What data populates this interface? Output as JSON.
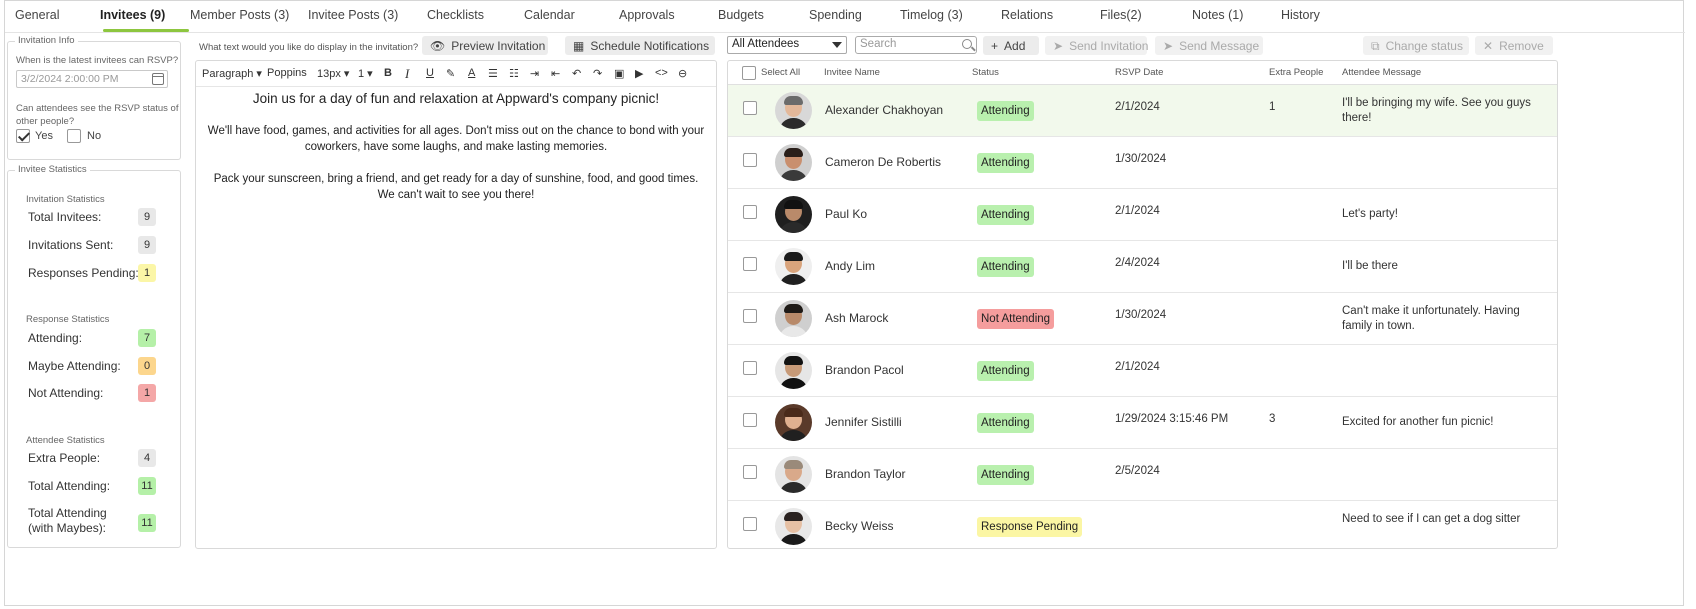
{
  "tabs": [
    {
      "label": "General"
    },
    {
      "label": "Invitees (9)"
    },
    {
      "label": "Member Posts (3)"
    },
    {
      "label": "Invitee Posts (3)"
    },
    {
      "label": "Checklists"
    },
    {
      "label": "Calendar"
    },
    {
      "label": "Approvals"
    },
    {
      "label": "Budgets"
    },
    {
      "label": "Spending"
    },
    {
      "label": "Timelog (3)"
    },
    {
      "label": "Relations"
    },
    {
      "label": "Files(2)"
    },
    {
      "label": "Notes (1)"
    },
    {
      "label": "History"
    }
  ],
  "active_tab": "Invitees (9)",
  "invitation_info": {
    "legend": "Invitation Info",
    "rsvp_question": "When is the latest invitees can RSVP?",
    "rsvp_date": "3/2/2024 2:00:00 PM",
    "visibility_question": "Can attendees see the RSVP status of other people?",
    "yes_label": "Yes",
    "yes_checked": true,
    "no_label": "No",
    "no_checked": false
  },
  "stats": {
    "legend": "Invitee Statistics",
    "invitation_heading": "Invitation Statistics",
    "total_invitees_label": "Total Invitees:",
    "total_invitees": "9",
    "invitations_sent_label": "Invitations Sent:",
    "invitations_sent": "9",
    "responses_pending_label": "Responses Pending:",
    "responses_pending": "1",
    "response_heading": "Response Statistics",
    "attending_label": "Attending:",
    "attending": "7",
    "maybe_label": "Maybe Attending:",
    "maybe": "0",
    "not_attending_label": "Not Attending:",
    "not_attending": "1",
    "attendee_heading": "Attendee Statistics",
    "extra_people_label": "Extra People:",
    "extra_people": "4",
    "total_attending_label": "Total Attending:",
    "total_attending": "11",
    "total_with_maybes_label": "Total Attending (with Maybes):",
    "total_with_maybes": "11"
  },
  "editor": {
    "question": "What text would you like do display in the invitation?",
    "preview_button": "Preview Invitation",
    "schedule_button": "Schedule Notifications",
    "block_format": "Paragraph",
    "font_name": "Poppins",
    "font_size": "13px",
    "line_height": "1",
    "paragraphs": [
      "Join us for a day of fun and relaxation at Appward's company picnic!",
      "We'll have food, games, and activities for all ages. Don't miss out on the chance to bond with your coworkers, have some laughs, and make lasting memories.",
      "Pack your sunscreen, bring a friend, and get ready for a day of sunshine, food, and good times. We can't wait to see you there!"
    ]
  },
  "toolbar": {
    "filter_value": "All Attendees",
    "search_placeholder": "Search",
    "add_label": "Add",
    "send_invitation_label": "Send Invitation",
    "send_message_label": "Send Message",
    "change_status_label": "Change status",
    "remove_label": "Remove"
  },
  "table": {
    "columns": [
      "Select All",
      "Invitee Name",
      "Status",
      "RSVP Date",
      "Extra People",
      "Attendee Message"
    ],
    "rows": [
      {
        "name": "Alexander Chakhoyan",
        "status": "Attending",
        "rsvp": "2/1/2024",
        "extra": "1",
        "message": "I'll be bringing my wife. See you guys there!"
      },
      {
        "name": "Cameron De Robertis",
        "status": "Attending",
        "rsvp": "1/30/2024",
        "extra": "",
        "message": ""
      },
      {
        "name": "Paul Ko",
        "status": "Attending",
        "rsvp": "2/1/2024",
        "extra": "",
        "message": "Let's party!"
      },
      {
        "name": "Andy Lim",
        "status": "Attending",
        "rsvp": "2/4/2024",
        "extra": "",
        "message": "I'll be there"
      },
      {
        "name": "Ash Marock",
        "status": "Not Attending",
        "rsvp": "1/30/2024",
        "extra": "",
        "message": "Can't make it unfortunately. Having family in town."
      },
      {
        "name": "Brandon Pacol",
        "status": "Attending",
        "rsvp": "2/1/2024",
        "extra": "",
        "message": ""
      },
      {
        "name": "Jennifer Sistilli",
        "status": "Attending",
        "rsvp": "1/29/2024 3:15:46 PM",
        "extra": "3",
        "message": "Excited for another fun picnic!"
      },
      {
        "name": "Brandon Taylor",
        "status": "Attending",
        "rsvp": "2/5/2024",
        "extra": "",
        "message": ""
      },
      {
        "name": "Becky Weiss",
        "status": "Response Pending",
        "rsvp": "",
        "extra": "",
        "message": "Need to see if I can get a dog sitter"
      }
    ]
  },
  "colors": {
    "accent": "#8dc63f",
    "attending": "#b9f0ae",
    "not_attending": "#f59d9d",
    "pending": "#fbf6a4",
    "highlight_row": "#f2f9ec"
  }
}
